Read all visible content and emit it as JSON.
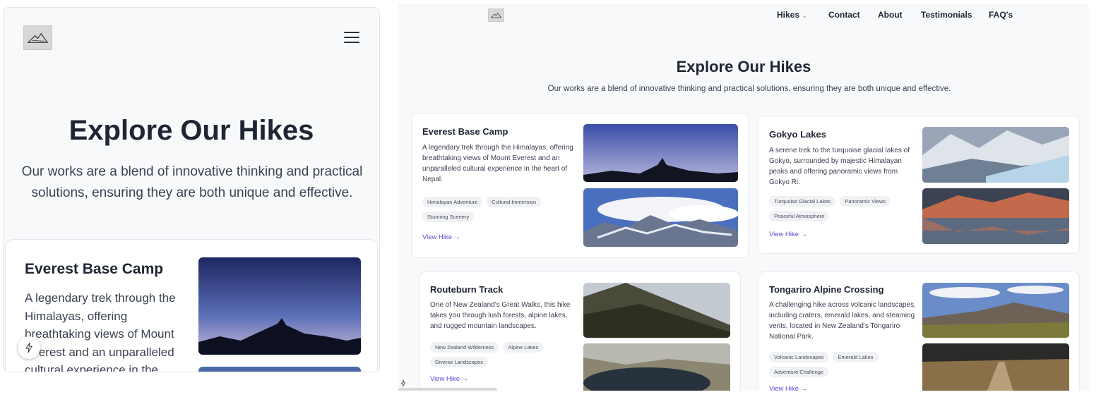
{
  "page": {
    "title": "Explore Our Hikes",
    "subtitle": "Our works are a blend of innovative thinking and practical solutions, ensuring they are both unique and effective."
  },
  "nav": {
    "hikes": "Hikes",
    "contact": "Contact",
    "about": "About",
    "testimonials": "Testimonials",
    "faqs": "FAQ's"
  },
  "mobile": {
    "card": {
      "title": "Everest Base Camp",
      "description": "A legendary trek through the Himalayas, offering breathtaking views of Mount Everest and an unparalleled cultural experience in the heart of Nepal."
    }
  },
  "hikes": [
    {
      "title": "Everest Base Camp",
      "description": "A legendary trek through the Himalayas, offering breathtaking views of Mount Everest and an unparalleled cultural experience in the heart of Nepal.",
      "tags": [
        "Himalayan Adventure",
        "Cultural Immersion",
        "Stunning Scenery"
      ],
      "link": "View Hike →"
    },
    {
      "title": "Gokyo Lakes",
      "description": "A serene trek to the turquoise glacial lakes of Gokyo, surrounded by majestic Himalayan peaks and offering panoramic views from Gokyo Ri.",
      "tags": [
        "Turquoise Glacial Lakes",
        "Panoramic Views",
        "Peaceful Atmosphere"
      ],
      "link": "View Hike →"
    },
    {
      "title": "Routeburn Track",
      "description": "One of New Zealand's Great Walks, this hike takes you through lush forests, alpine lakes, and rugged mountain landscapes.",
      "tags": [
        "New Zealand Wilderness",
        "Alpine Lakes",
        "Diverse Landscapes"
      ],
      "link": "View Hike →"
    },
    {
      "title": "Tongariro Alpine Crossing",
      "description": "A challenging hike across volcanic landscapes, including craters, emerald lakes, and steaming vents, located in New Zealand's Tongariro National Park.",
      "tags": [
        "Volcanic Landscapes",
        "Emerald Lakes",
        "Adventure Challenge"
      ],
      "link": "View Hike →"
    }
  ],
  "colors": {
    "accent": "#5b4cd6",
    "background": "#f8f9fb",
    "text": "#1f2633"
  }
}
